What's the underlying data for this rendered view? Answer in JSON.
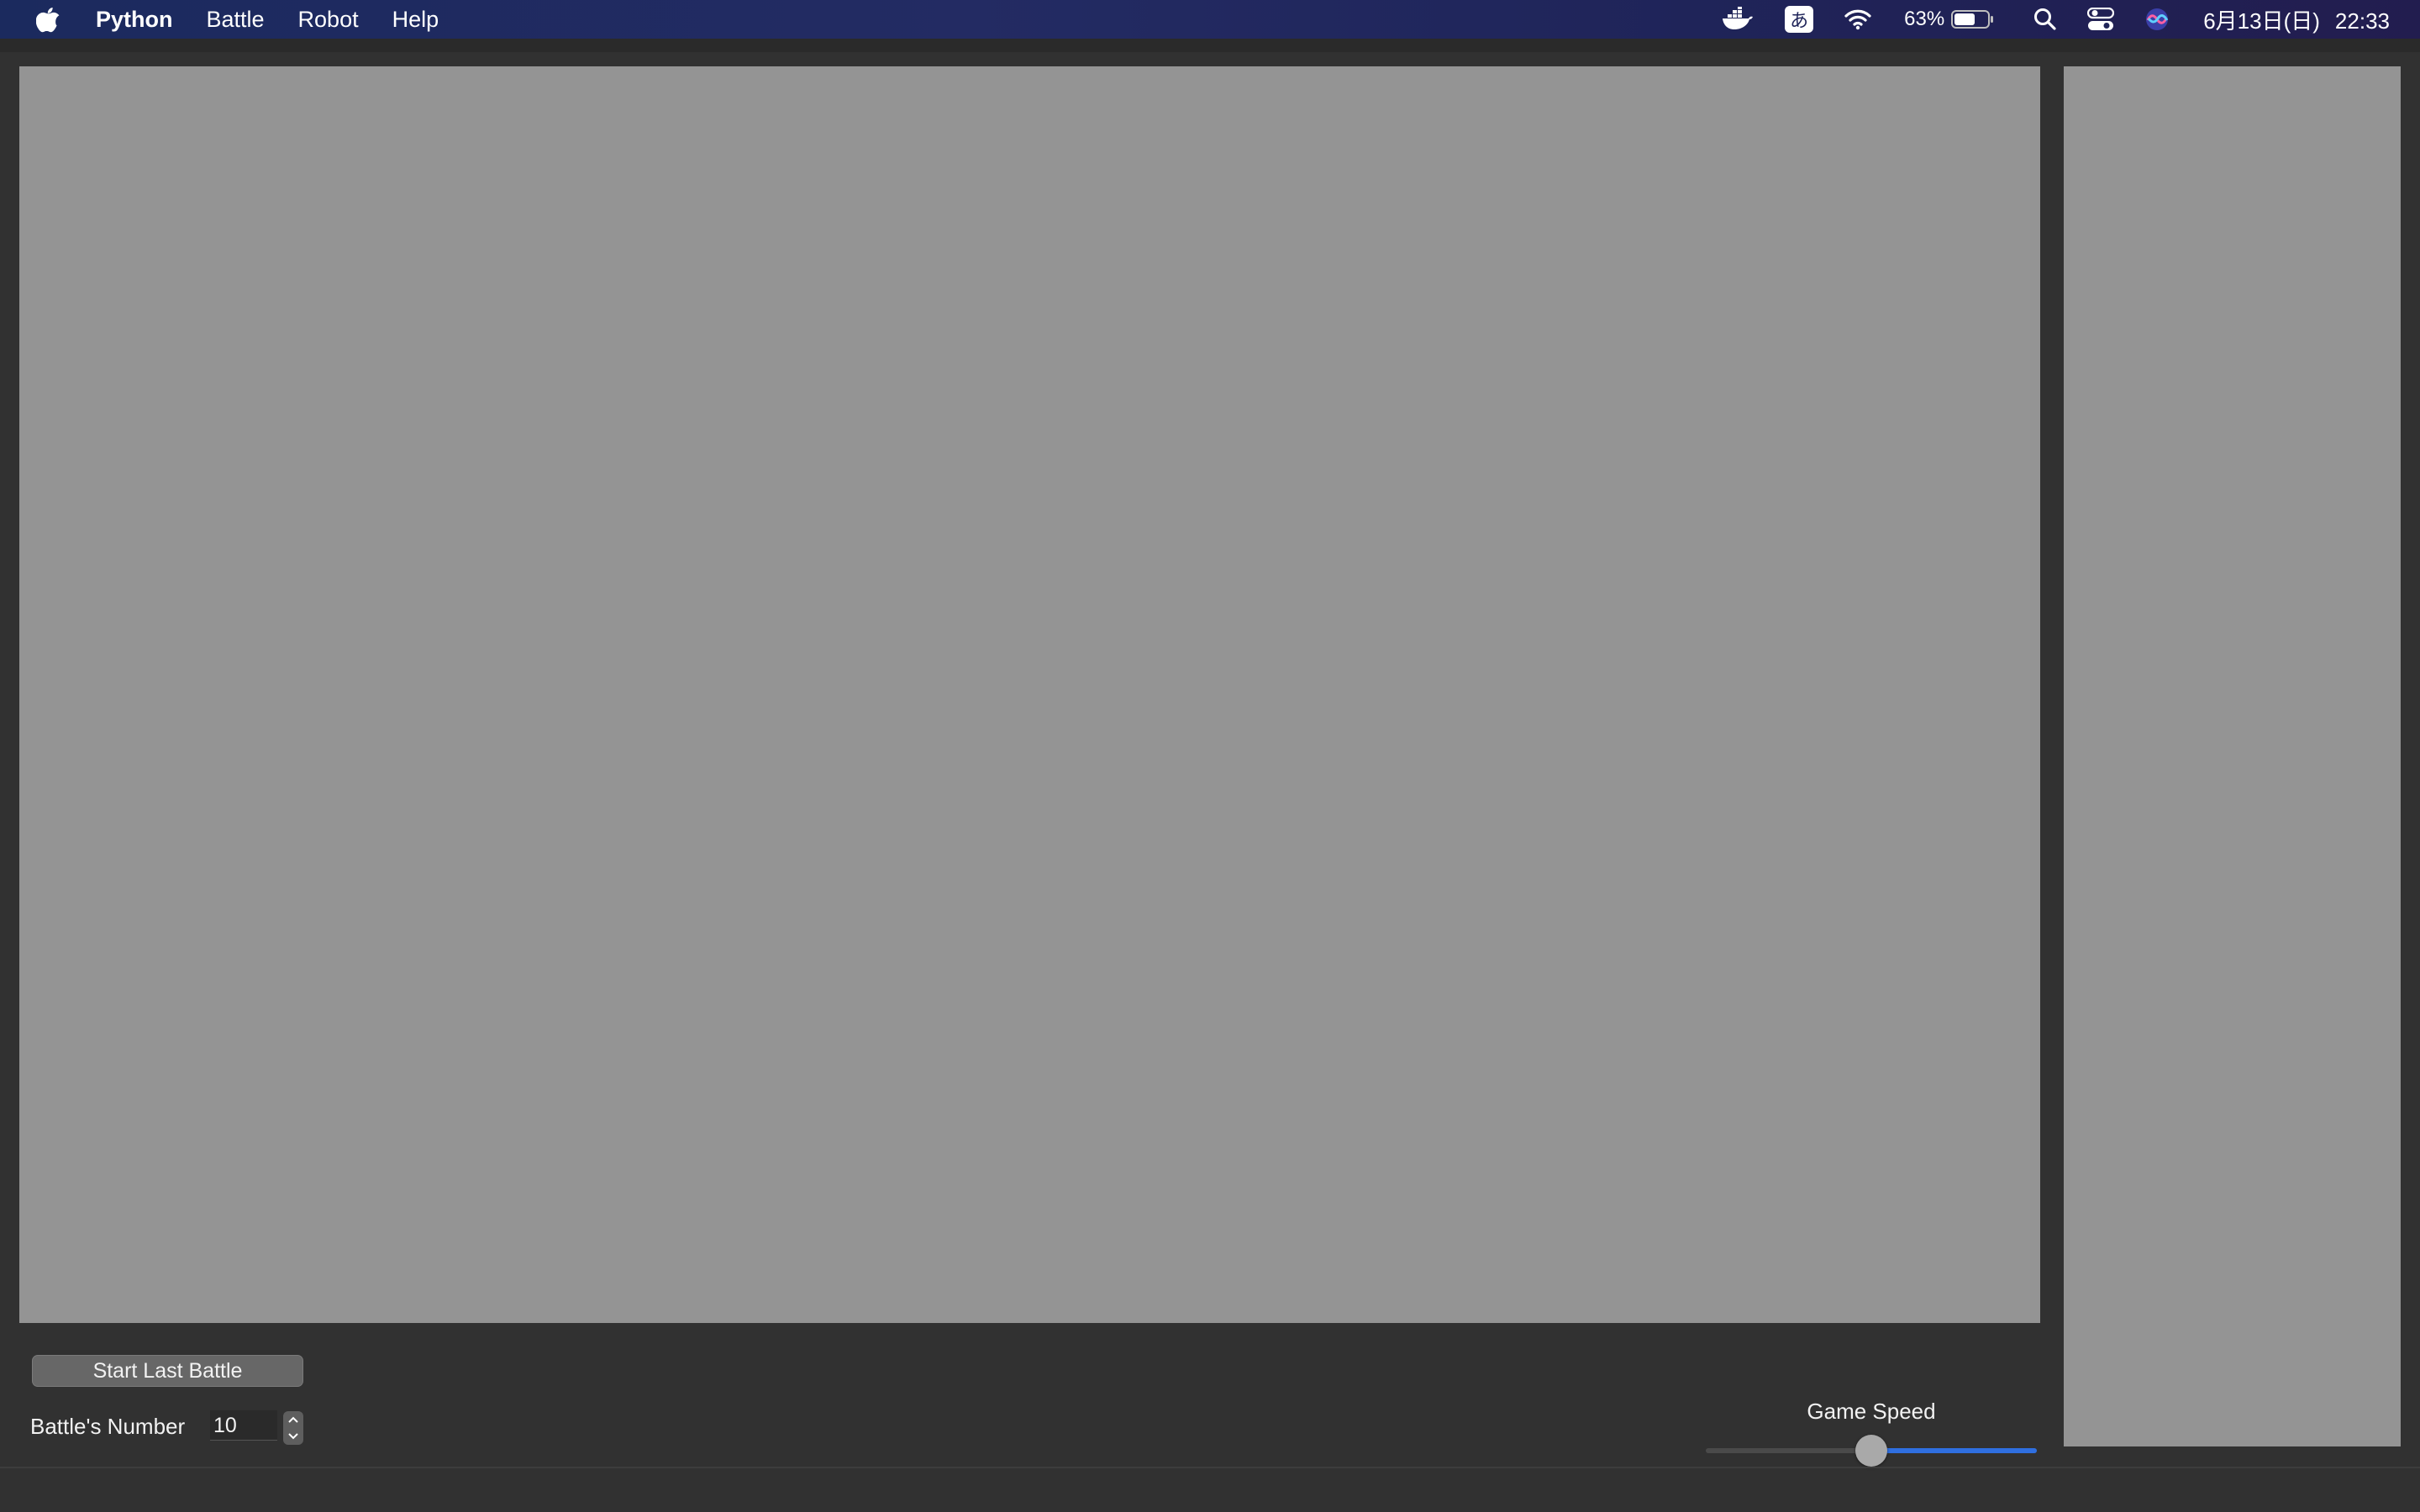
{
  "menubar": {
    "apple_icon": "apple-logo-icon",
    "app_name": "Python",
    "items": [
      "Battle",
      "Robot",
      "Help"
    ],
    "status": {
      "icons": [
        "docker-whale-icon",
        "input-method-icon",
        "wifi-icon",
        "battery-icon",
        "search-icon",
        "control-center-icon",
        "siri-icon"
      ],
      "input_method_label": "あ",
      "battery_percent": "63%",
      "battery_level": 0.63,
      "date": "6月13日(日)",
      "time": "22:33"
    }
  },
  "controls": {
    "start_button_label": "Start Last Battle",
    "battles_label": "Battle's Number",
    "battles_value": "10",
    "speed_label": "Game Speed",
    "speed_value": 0.5,
    "accent_color": "#2f6fe0"
  },
  "colors": {
    "arena_background": "#949494",
    "window_background": "#313131"
  }
}
